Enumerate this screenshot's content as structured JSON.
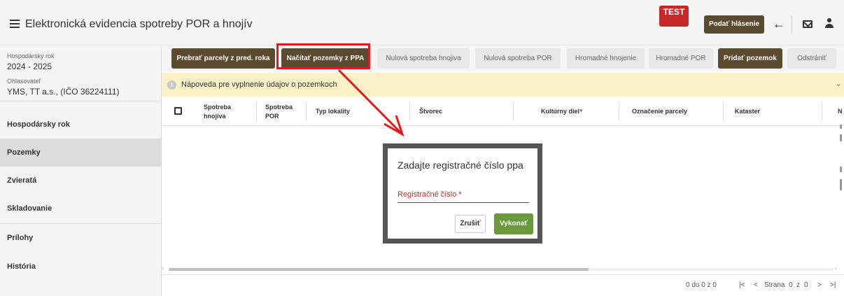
{
  "header": {
    "title": "Elektronická evidencia spotreby POR a hnojív",
    "test_badge": "TEST",
    "submit_label": "Podať hlásenie",
    "back_icon": "arrow-left-icon",
    "mail_icon": "mail-icon",
    "user_icon": "user-icon"
  },
  "sidebar": {
    "year_label": "Hospodársky rok",
    "year_value": "2024 - 2025",
    "reporter_label": "Ohlasovateľ",
    "reporter_value": "YMS, TT a.s., (IČO 36224111)",
    "items": [
      {
        "label": "Hospodársky rok"
      },
      {
        "label": "Pozemky"
      },
      {
        "label": "Zvieratá"
      },
      {
        "label": "Skladovanie"
      },
      {
        "label": "Prílohy"
      },
      {
        "label": "História"
      }
    ]
  },
  "toolbar": {
    "buttons": [
      {
        "label": "Prebrať parcely z pred. roka"
      },
      {
        "label": "Načítať pozemky z PPA"
      },
      {
        "label": "Nulová spotreba hnojiva"
      },
      {
        "label": "Nulová spotreba POR"
      },
      {
        "label": "Hromadné hnojenie"
      },
      {
        "label": "Hromadné POR"
      },
      {
        "label": "Pridať pozemok"
      },
      {
        "label": "Odstrániť"
      }
    ]
  },
  "help": {
    "text": "Nápoveda pre vyplnenie údajov o pozemkoch"
  },
  "table": {
    "columns": [
      {
        "line1": "Spotreba",
        "line2": "hnojiva"
      },
      {
        "line1": "Spotreba",
        "line2": "POR"
      },
      {
        "label": "Typ lokality"
      },
      {
        "label": "Štvorec"
      },
      {
        "label": "Kultúrny diel"
      },
      {
        "label": "Označenie parcely"
      },
      {
        "label": "Kataster"
      }
    ],
    "sort_icon": "sort-down-icon"
  },
  "pagination": {
    "range": "0 do 0 z 0",
    "page_label": "Strana",
    "page": "0",
    "of": "z",
    "total": "0",
    "first_icon": "|<",
    "prev_icon": "<",
    "next_icon": ">",
    "last_icon": ">|"
  },
  "dialog": {
    "title": "Zadajte registračné číslo ppa",
    "input_label": "Registračné číslo *",
    "cancel_label": "Zrušiť",
    "ok_label": "Vykonať"
  },
  "colors": {
    "primary_brown": "#5a4a2e",
    "highlight_red": "#e01b1b",
    "help_bg": "#fbf1c8",
    "ok_green": "#6a9a3d"
  }
}
